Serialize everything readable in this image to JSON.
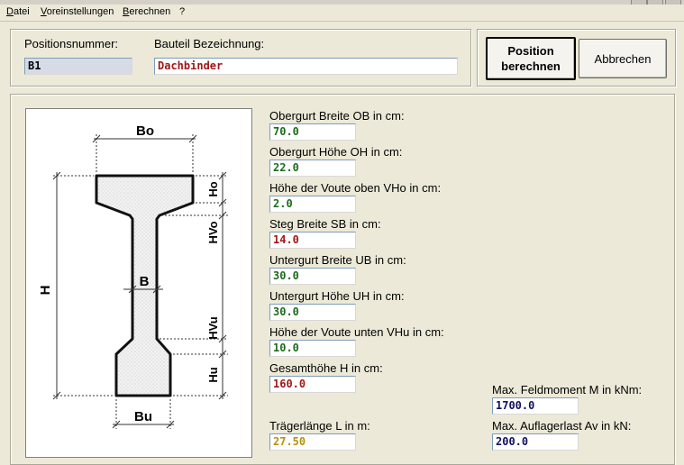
{
  "menu": {
    "file": "Datei",
    "prefs": "Voreinstellungen",
    "calc": "Berechnen",
    "help": "?"
  },
  "header": {
    "position_label": "Positionsnummer:",
    "position_value": "B1",
    "name_label": "Bauteil Bezeichnung:",
    "name_value": "Dachbinder",
    "calc_button": "Position berechnen",
    "cancel_button": "Abbrechen"
  },
  "diagram": {
    "labels": {
      "bo": "Bo",
      "ho": "Ho",
      "hvo": "HVo",
      "h": "H",
      "b": "B",
      "hvu": "HVu",
      "hu": "Hu",
      "bu": "Bu"
    }
  },
  "fields": [
    {
      "label": "Obergurt Breite OB in cm:",
      "value": "70.0",
      "color": "#1e6b1e"
    },
    {
      "label": "Obergurt Höhe OH in cm:",
      "value": "22.0",
      "color": "#1e6b1e"
    },
    {
      "label": "Höhe der Voute oben VHo in cm:",
      "value": "2.0",
      "color": "#1e6b1e"
    },
    {
      "label": "Steg Breite SB in cm:",
      "value": "14.0",
      "color": "#a01818"
    },
    {
      "label": "Untergurt Breite UB in cm:",
      "value": "30.0",
      "color": "#1e6b1e"
    },
    {
      "label": "Untergurt Höhe UH in cm:",
      "value": "30.0",
      "color": "#1e6b1e"
    },
    {
      "label": "Höhe der Voute unten VHu in cm:",
      "value": "10.0",
      "color": "#1e6b1e"
    },
    {
      "label": "Gesamthöhe H in cm:",
      "value": "160.0",
      "color": "#a01818"
    }
  ],
  "span": {
    "label": "Trägerlänge L in m:",
    "value": "27.50",
    "color": "#b8900c"
  },
  "results": {
    "moment_label": "Max. Feldmoment M in kNm:",
    "moment_value": "1700.0",
    "support_label": "Max. Auflagerlast Av in kN:",
    "support_value": "200.0"
  }
}
